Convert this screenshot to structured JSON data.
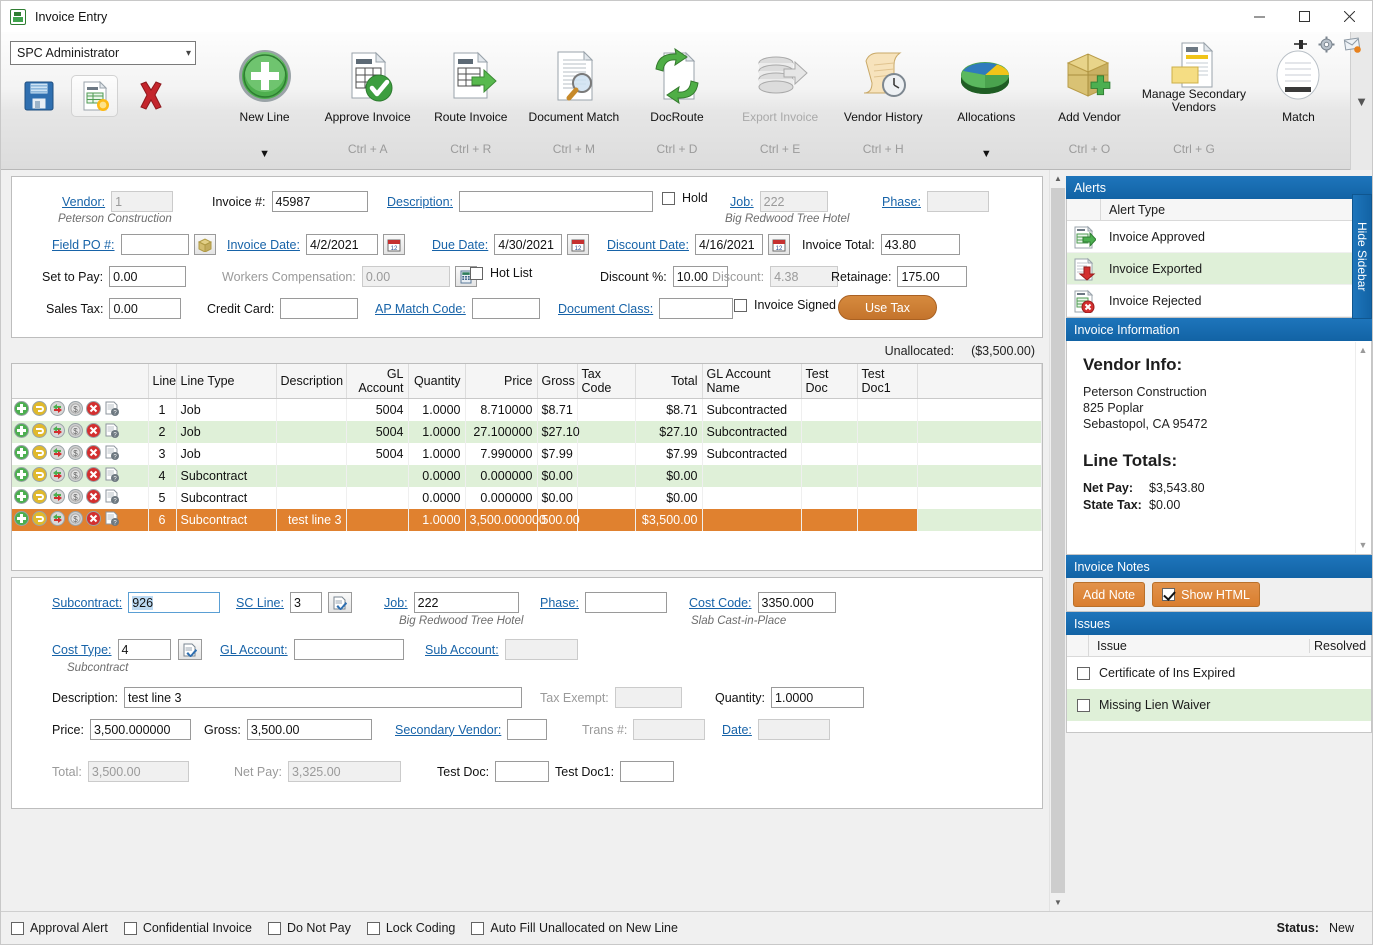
{
  "window": {
    "title": "Invoice Entry",
    "app_icon": "invoice-app-icon",
    "minimize": "minimize-icon",
    "maximize": "maximize-icon",
    "close": "close-icon",
    "pin": "pin-icon",
    "gear": "gear-icon",
    "mail": "mail-alert-icon"
  },
  "ribbon": {
    "user_select": {
      "value": "SPC Administrator"
    },
    "quick": [
      {
        "name": "save-button",
        "icon": "floppy-disk-icon"
      },
      {
        "name": "new-invoice-button",
        "icon": "new-invoice-icon"
      },
      {
        "name": "delete-button",
        "icon": "red-x-icon"
      }
    ],
    "items": [
      {
        "label": "New Line",
        "shortcut": "",
        "icon": "green-plus-circle-icon",
        "dropdown": true,
        "disabled": false
      },
      {
        "label": "Approve Invoice",
        "shortcut": "Ctrl + A",
        "icon": "invoice-check-icon",
        "dropdown": false,
        "disabled": false
      },
      {
        "label": "Route Invoice",
        "shortcut": "Ctrl + R",
        "icon": "invoice-arrow-icon",
        "dropdown": false,
        "disabled": false
      },
      {
        "label": "Document Match",
        "shortcut": "Ctrl + M",
        "icon": "document-magnifier-icon",
        "dropdown": false,
        "disabled": false
      },
      {
        "label": "DocRoute",
        "shortcut": "Ctrl + D",
        "icon": "doc-recycle-icon",
        "dropdown": false,
        "disabled": false
      },
      {
        "label": "Export Invoice",
        "shortcut": "Ctrl + E",
        "icon": "database-export-icon",
        "dropdown": false,
        "disabled": true
      },
      {
        "label": "Vendor History",
        "shortcut": "Ctrl + H",
        "icon": "scroll-clock-icon",
        "dropdown": false,
        "disabled": false
      },
      {
        "label": "Allocations",
        "shortcut": "",
        "icon": "pie-chart-icon",
        "dropdown": true,
        "disabled": false
      },
      {
        "label": "Add Vendor",
        "shortcut": "Ctrl + O",
        "icon": "box-plus-icon",
        "dropdown": false,
        "disabled": false
      },
      {
        "label": "Manage Secondary Vendors",
        "shortcut": "Ctrl + G",
        "icon": "sales-quotation-icon",
        "dropdown": false,
        "disabled": false
      },
      {
        "label": "Match",
        "shortcut": "",
        "icon": "receipt-icon",
        "dropdown": false,
        "disabled": false
      }
    ],
    "scroll_down_icon": "chevron-down-icon"
  },
  "header_form": {
    "vendor": {
      "label": "Vendor:",
      "value": "1",
      "note": "Peterson Construction"
    },
    "invoice_no": {
      "label": "Invoice #:",
      "value": "45987"
    },
    "description": {
      "label": "Description:",
      "value": ""
    },
    "hold": {
      "label": "Hold",
      "checked": false
    },
    "job": {
      "label": "Job:",
      "value": "222",
      "note": "Big Redwood Tree Hotel"
    },
    "phase": {
      "label": "Phase:",
      "value": ""
    },
    "field_po": {
      "label": "Field PO #:",
      "value": ""
    },
    "invoice_date": {
      "label": "Invoice Date:",
      "value": "4/2/2021"
    },
    "due_date": {
      "label": "Due Date:",
      "value": "4/30/2021"
    },
    "discount_date": {
      "label": "Discount Date:",
      "value": "4/16/2021"
    },
    "invoice_total": {
      "label": "Invoice Total:",
      "value": "43.80"
    },
    "set_to_pay": {
      "label": "Set to Pay:",
      "value": "0.00"
    },
    "workers_comp": {
      "label": "Workers Compensation:",
      "value": "0.00"
    },
    "hot_list": {
      "label": "Hot List",
      "checked": false
    },
    "discount_pct": {
      "label": "Discount %:",
      "value": "10.00"
    },
    "discount": {
      "label": "Discount:",
      "value": "4.38"
    },
    "retainage": {
      "label": "Retainage:",
      "value": "175.00"
    },
    "sales_tax": {
      "label": "Sales Tax:",
      "value": "0.00"
    },
    "credit_card": {
      "label": "Credit Card:",
      "value": ""
    },
    "ap_match_code": {
      "label": "AP Match Code:",
      "value": ""
    },
    "document_class": {
      "label": "Document Class:",
      "value": ""
    },
    "invoice_signed": {
      "label": "Invoice Signed",
      "checked": false
    },
    "use_tax_button": "Use Tax",
    "calendar_icon": "calendar-icon",
    "lookup_icon": "lookup-box-icon",
    "calculator_icon": "calculator-icon"
  },
  "unallocated": {
    "label": "Unallocated:",
    "value": "($3,500.00)"
  },
  "grid": {
    "row_action_icons": [
      "add-line-icon",
      "undo-line-icon",
      "refresh-line-icon",
      "dollar-line-icon",
      "delete-line-icon",
      "line-info-icon"
    ],
    "columns": [
      "Line",
      "Line Type",
      "Description",
      "GL Account",
      "Quantity",
      "Price",
      "Gross",
      "Tax Code",
      "Total",
      "GL Account Name",
      "Test Doc",
      "Test Doc1"
    ],
    "rows": [
      {
        "line": "1",
        "line_type": "Job",
        "description": "",
        "gl_account": "5004",
        "quantity": "1.0000",
        "price": "8.710000",
        "gross": "$8.71",
        "tax_code": "",
        "total": "$8.71",
        "gl_account_name": "Subcontracted",
        "test_doc": "",
        "test_doc1": "",
        "state": "normal"
      },
      {
        "line": "2",
        "line_type": "Job",
        "description": "",
        "gl_account": "5004",
        "quantity": "1.0000",
        "price": "27.100000",
        "gross": "$27.10",
        "tax_code": "",
        "total": "$27.10",
        "gl_account_name": "Subcontracted",
        "test_doc": "",
        "test_doc1": "",
        "state": "alt"
      },
      {
        "line": "3",
        "line_type": "Job",
        "description": "",
        "gl_account": "5004",
        "quantity": "1.0000",
        "price": "7.990000",
        "gross": "$7.99",
        "tax_code": "",
        "total": "$7.99",
        "gl_account_name": "Subcontracted",
        "test_doc": "",
        "test_doc1": "",
        "state": "normal"
      },
      {
        "line": "4",
        "line_type": "Subcontract",
        "description": "",
        "gl_account": "",
        "quantity": "0.0000",
        "price": "0.000000",
        "gross": "$0.00",
        "tax_code": "",
        "total": "$0.00",
        "gl_account_name": "",
        "test_doc": "",
        "test_doc1": "",
        "state": "alt"
      },
      {
        "line": "5",
        "line_type": "Subcontract",
        "description": "",
        "gl_account": "",
        "quantity": "0.0000",
        "price": "0.000000",
        "gross": "$0.00",
        "tax_code": "",
        "total": "$0.00",
        "gl_account_name": "",
        "test_doc": "",
        "test_doc1": "",
        "state": "normal"
      },
      {
        "line": "6",
        "line_type": "Subcontract",
        "description": "test line 3",
        "gl_account": "",
        "quantity": "1.0000",
        "price": "3,500.000000",
        "gross": "500.00",
        "tax_code": "",
        "total": "$3,500.00",
        "gl_account_name": "",
        "test_doc": "",
        "test_doc1": "",
        "state": "selected"
      }
    ]
  },
  "detail_form": {
    "subcontract": {
      "label": "Subcontract:",
      "value": "926"
    },
    "sc_line": {
      "label": "SC Line:",
      "value": "3"
    },
    "job": {
      "label": "Job:",
      "value": "222",
      "note": "Big Redwood Tree Hotel"
    },
    "phase": {
      "label": "Phase:",
      "value": ""
    },
    "cost_code": {
      "label": "Cost Code:",
      "value": "3350.000",
      "note": "Slab Cast-in-Place"
    },
    "cost_type": {
      "label": "Cost Type:",
      "value": "4",
      "note": "Subcontract"
    },
    "gl_account": {
      "label": "GL Account:",
      "value": ""
    },
    "sub_account": {
      "label": "Sub Account:",
      "value": ""
    },
    "description": {
      "label": "Description:",
      "value": "test line 3"
    },
    "tax_exempt": {
      "label": "Tax Exempt:",
      "value": ""
    },
    "quantity": {
      "label": "Quantity:",
      "value": "1.0000"
    },
    "price": {
      "label": "Price:",
      "value": "3,500.000000"
    },
    "gross": {
      "label": "Gross:",
      "value": "3,500.00"
    },
    "secondary_vendor": {
      "label": "Secondary Vendor:",
      "value": ""
    },
    "trans_no": {
      "label": "Trans #:",
      "value": ""
    },
    "date": {
      "label": "Date:",
      "value": ""
    },
    "total": {
      "label": "Total:",
      "value": "3,500.00"
    },
    "net_pay": {
      "label": "Net Pay:",
      "value": "3,325.00"
    },
    "test_doc": {
      "label": "Test Doc:",
      "value": ""
    },
    "test_doc1": {
      "label": "Test Doc1:",
      "value": ""
    },
    "lookup_icon": "lookup-check-icon"
  },
  "sidebar": {
    "hide_tab": "Hide Sidebar",
    "alerts": {
      "title": "Alerts",
      "column": "Alert Type",
      "rows": [
        {
          "label": "Invoice Approved",
          "icon": "invoice-approved-icon",
          "state": "normal"
        },
        {
          "label": "Invoice Exported",
          "icon": "invoice-exported-icon",
          "state": "alt"
        },
        {
          "label": "Invoice Rejected",
          "icon": "invoice-rejected-icon",
          "state": "normal"
        }
      ]
    },
    "invoice_information": {
      "title": "Invoice Information",
      "vendor_heading": "Vendor Info:",
      "vendor_lines": [
        "Peterson Construction",
        "825 Poplar",
        "Sebastopol, CA 95472"
      ],
      "line_totals_heading": "Line Totals:",
      "totals": [
        {
          "key": "Net Pay:",
          "value": "$3,543.80"
        },
        {
          "key": "State Tax:",
          "value": "$0.00"
        }
      ]
    },
    "invoice_notes": {
      "title": "Invoice Notes",
      "add_note": "Add Note",
      "show_html": "Show HTML",
      "show_html_checked": true
    },
    "issues": {
      "title": "Issues",
      "columns": [
        "Issue",
        "Resolved"
      ],
      "rows": [
        {
          "label": "Certificate of Ins Expired",
          "checked": false,
          "state": "normal"
        },
        {
          "label": "Missing Lien Waiver",
          "checked": false,
          "state": "alt"
        }
      ]
    }
  },
  "status_bar": {
    "checkboxes": [
      {
        "label": "Approval Alert",
        "checked": false
      },
      {
        "label": "Confidential Invoice",
        "checked": false
      },
      {
        "label": "Do Not Pay",
        "checked": false
      },
      {
        "label": "Lock Coding",
        "checked": false
      },
      {
        "label": "Auto Fill Unallocated on New Line",
        "checked": false
      }
    ],
    "status_label": "Status:",
    "status_value": "New"
  },
  "colors": {
    "accent_blue": "#1263a5",
    "alt_row_green": "#dff0d8",
    "selected_orange": "#e0812f",
    "link_blue": "#1763a8"
  }
}
